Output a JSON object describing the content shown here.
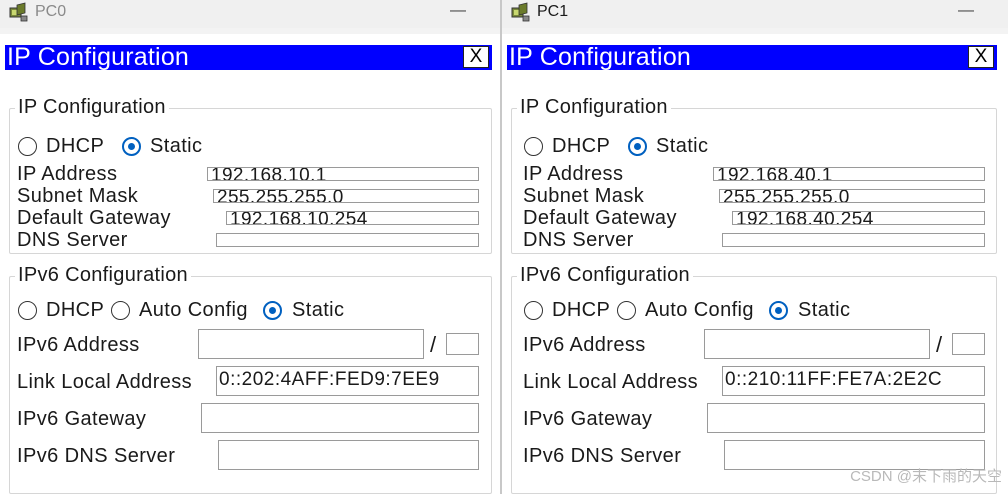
{
  "watermark": "CSDN @末下雨的天空",
  "windows": [
    {
      "title": "PC0",
      "minimize": "—",
      "banner": "IP Configuration",
      "close": "X",
      "ipv4": {
        "legend": "IP Configuration",
        "dhcp_label": "DHCP",
        "static_label": "Static",
        "selected": "static",
        "ip_label": "IP Address",
        "ip_value": "192.168.10.1",
        "mask_label": "Subnet Mask",
        "mask_value": "255.255.255.0",
        "gw_label": "Default Gateway",
        "gw_value": "192.168.10.254",
        "dns_label": "DNS Server",
        "dns_value": ""
      },
      "ipv6": {
        "legend": "IPv6 Configuration",
        "dhcp_label": "DHCP",
        "auto_label": "Auto Config",
        "static_label": "Static",
        "selected": "static",
        "addr_label": "IPv6 Address",
        "addr_value": "",
        "slash": "/",
        "prefix_value": "",
        "link_label": "Link Local Address",
        "link_value": "0::202:4AFF:FED9:7EE9",
        "gw_label": "IPv6 Gateway",
        "gw_value": "",
        "dns_label": "IPv6 DNS Server",
        "dns_value": ""
      }
    },
    {
      "title": "PC1",
      "minimize": "—",
      "banner": "IP Configuration",
      "close": "X",
      "ipv4": {
        "legend": "IP Configuration",
        "dhcp_label": "DHCP",
        "static_label": "Static",
        "selected": "static",
        "ip_label": "IP Address",
        "ip_value": "192.168.40.1",
        "mask_label": "Subnet Mask",
        "mask_value": "255.255.255.0",
        "gw_label": "Default Gateway",
        "gw_value": "192.168.40.254",
        "dns_label": "DNS Server",
        "dns_value": ""
      },
      "ipv6": {
        "legend": "IPv6 Configuration",
        "dhcp_label": "DHCP",
        "auto_label": "Auto Config",
        "static_label": "Static",
        "selected": "static",
        "addr_label": "IPv6 Address",
        "addr_value": "",
        "slash": "/",
        "prefix_value": "",
        "link_label": "Link Local Address",
        "link_value": "0::210:11FF:FE7A:2E2C",
        "gw_label": "IPv6 Gateway",
        "gw_value": "",
        "dns_label": "IPv6 DNS Server",
        "dns_value": ""
      }
    }
  ]
}
